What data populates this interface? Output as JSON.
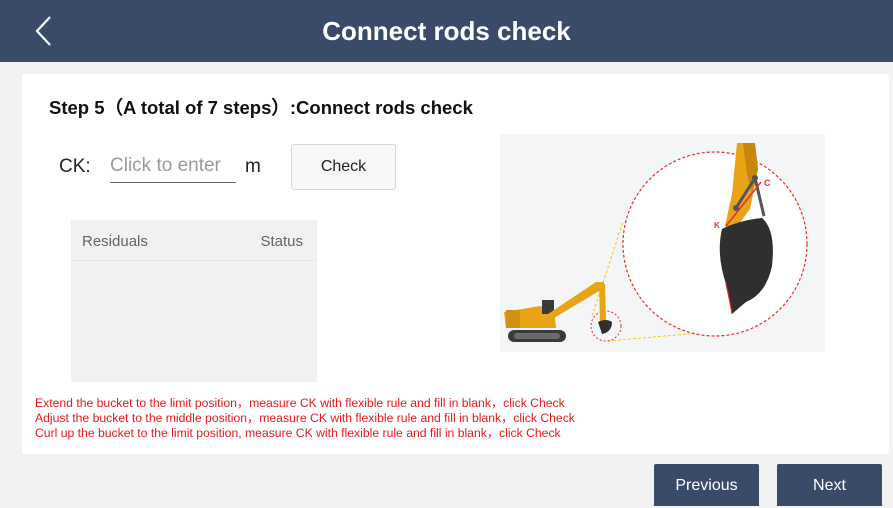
{
  "header": {
    "title": "Connect rods check",
    "back_icon": "chevron-left-icon"
  },
  "step": {
    "title": "Step 5（A total of 7 steps）:Connect rods check"
  },
  "ck": {
    "label": "CK:",
    "placeholder": "Click to enter",
    "value": "",
    "unit": "m",
    "check_label": "Check"
  },
  "table": {
    "columns": [
      "Residuals",
      "Status"
    ],
    "rows": []
  },
  "diagram": {
    "point_c_label": "C",
    "point_k_label": "K"
  },
  "instructions": [
    "Extend the bucket to the limit position，measure CK with flexible rule and fill in blank，click Check",
    "Adjust the bucket to the middle position，measure CK with flexible rule and fill in blank，click Check",
    "Curl up the bucket to the limit position, measure CK with flexible rule and fill in blank，click Check"
  ],
  "footer": {
    "previous_label": "Previous",
    "next_label": "Next"
  },
  "colors": {
    "header_bg": "#3a4a69",
    "instruction_text": "#e21b1b",
    "excavator_body": "#e8a317"
  }
}
